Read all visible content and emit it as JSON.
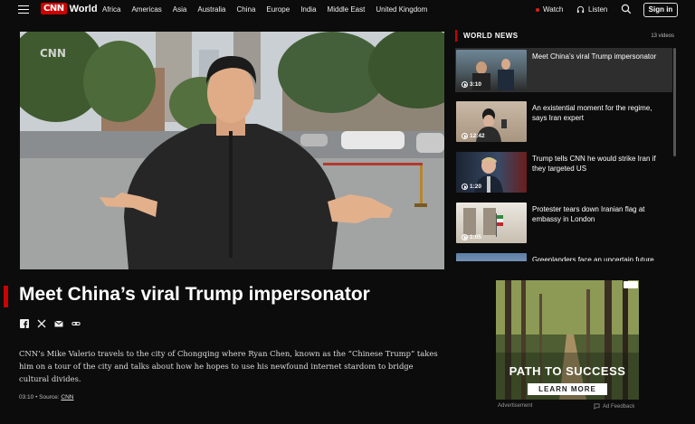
{
  "header": {
    "brand_mark": "CNN",
    "brand_section": "World",
    "nav": [
      "Africa",
      "Americas",
      "Asia",
      "Australia",
      "China",
      "Europe",
      "India",
      "Middle East",
      "United Kingdom"
    ],
    "watch_label": "Watch",
    "listen_label": "Listen",
    "signin_label": "Sign in"
  },
  "rail": {
    "title": "WORLD NEWS",
    "count": "13 videos",
    "items": [
      {
        "title": "Meet China’s viral Trump impersonator",
        "duration": "3:10",
        "active": true
      },
      {
        "title": "An existential moment for the regime, says Iran expert",
        "duration": "12:42",
        "active": false
      },
      {
        "title": "Trump tells CNN he would strike Iran if they targeted US",
        "duration": "1:20",
        "active": false
      },
      {
        "title": "Protester tears down Iranian flag at embassy in London",
        "duration": "1:05",
        "active": false
      },
      {
        "title": "Greenlanders face an uncertain future amid Trump’s threats",
        "duration": "",
        "active": false
      }
    ]
  },
  "article": {
    "headline": "Meet China’s viral Trump impersonator",
    "description": "CNN’s Mike Valerio travels to the city of Chongqing where Ryan Chen, known as the “Chinese Trump” takes him on a tour of the city and talks about how he hopes to use his newfound internet stardom to bridge cultural divides.",
    "meta_prefix": "03:10 • Source: ",
    "source": "CNN",
    "video_bug": "CNN"
  },
  "ad": {
    "headline": "PATH TO SUCCESS",
    "button": "LEARN MORE",
    "label": "Advertisement",
    "feedback": "Ad Feedback"
  },
  "colors": {
    "brand_red": "#cc0000",
    "background": "#0c0c0c"
  }
}
